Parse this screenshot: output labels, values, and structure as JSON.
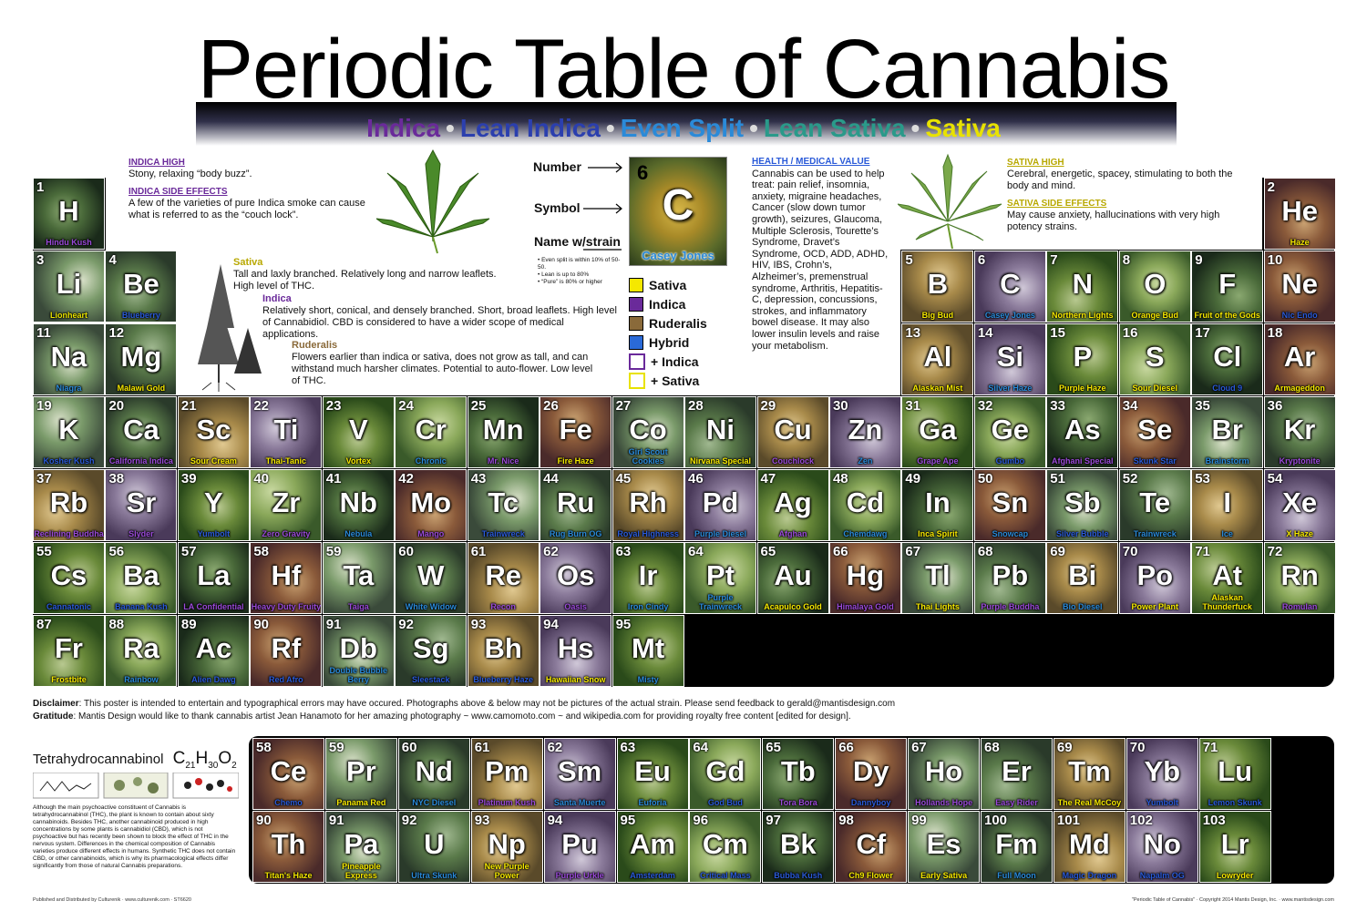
{
  "title": "Periodic Table of Cannabis",
  "types": [
    {
      "label": "Indica",
      "color": "#6a2a9a"
    },
    {
      "label": "Lean Indica",
      "color": "#2b3fae"
    },
    {
      "label": "Even Split",
      "color": "#2b8ad8"
    },
    {
      "label": "Lean Sativa",
      "color": "#2a9a8a"
    },
    {
      "label": "Sativa",
      "color": "#e8e200"
    }
  ],
  "type_separator": "•",
  "indica_info": {
    "high_heading": "INDICA HIGH",
    "high_text": "Stony, relaxing “body buzz”.",
    "side_heading": "INDICA SIDE EFFECTS",
    "side_text": "A few of the varieties of pure Indica smoke can cause what is referred to as the “couch lock”."
  },
  "sativa_info": {
    "high_heading": "SATIVA HIGH",
    "high_text": "Cerebral, energetic, spacey, stimulating to both the body and mind.",
    "side_heading": "SATIVA SIDE EFFECTS",
    "side_text": "May cause anxiety, hallucinations with very high potency strains."
  },
  "plants": {
    "sativa_label": "Sativa",
    "sativa_text": "Tall and laxly branched. Relatively long and narrow leaflets. High level of THC.",
    "indica_label": "Indica",
    "indica_text": "Relatively short, conical, and densely branched. Short, broad leaflets. High level of Cannabidiol. CBD is considered to have a wider scope of medical applications.",
    "ruderalis_label": "Ruderalis",
    "ruderalis_text": "Flowers earlier than indica or sativa, does not grow as tall, and can withstand much harsher climates. Potential to auto-flower. Low level of THC."
  },
  "key": {
    "number_label": "Number",
    "symbol_label": "Symbol",
    "name_label": "Name w/strain",
    "example_num": "6",
    "example_sym": "C",
    "example_strain": "Casey Jones",
    "notes": [
      "• Even split is within 10% of 50-50.",
      "• Lean is up to 80%",
      "• “Pure” is 80% or higher"
    ]
  },
  "legend": [
    {
      "label": "Sativa",
      "color": "#f5e800"
    },
    {
      "label": "Indica",
      "color": "#6a2a9a"
    },
    {
      "label": "Ruderalis",
      "color": "#8a6a3a"
    },
    {
      "label": "Hybrid",
      "color": "#2a6ad8"
    },
    {
      "label": "+ Indica",
      "color": "#ffffff",
      "border": "#6a2a9a"
    },
    {
      "label": "+ Sativa",
      "color": "#ffffff",
      "border": "#e8e200"
    }
  ],
  "health": {
    "heading": "HEALTH / MEDICAL VALUE",
    "text": "Cannabis can be used to help treat: pain relief, insomnia, anxiety, migraine headaches, Cancer (slow down tumor growth), seizures, Glaucoma, Multiple Sclerosis, Tourette’s Syndrome, Dravet’s Syndrome, OCD, ADD, ADHD, HIV, IBS, Crohn’s, Alzheimer’s, premenstrual syndrome, Arthritis, Hepatitis-C, depression, concussions, strokes, and inflammatory bowel disease. It may also lower insulin levels and raise your metabolism."
  },
  "elements": [
    {
      "n": "1",
      "s": "H",
      "name": "Hindu Kush",
      "c": "#9a4ad8",
      "r": 0,
      "col": 0
    },
    {
      "n": "2",
      "s": "He",
      "name": "Haze",
      "c": "#f5e800",
      "r": 0,
      "col": 17
    },
    {
      "n": "3",
      "s": "Li",
      "name": "Lionheart",
      "c": "#e8e200",
      "r": 1,
      "col": 0
    },
    {
      "n": "4",
      "s": "Be",
      "name": "Blueberry",
      "c": "#2a5ad8",
      "r": 1,
      "col": 1
    },
    {
      "n": "5",
      "s": "B",
      "name": "Big Bud",
      "c": "#f5e800",
      "r": 1,
      "col": 12
    },
    {
      "n": "6",
      "s": "C",
      "name": "Casey Jones",
      "c": "#2a8ad8",
      "r": 1,
      "col": 13
    },
    {
      "n": "7",
      "s": "N",
      "name": "Northern Lights",
      "c": "#f5e800",
      "r": 1,
      "col": 14
    },
    {
      "n": "8",
      "s": "O",
      "name": "Orange Bud",
      "c": "#f5e800",
      "r": 1,
      "col": 15
    },
    {
      "n": "9",
      "s": "F",
      "name": "Fruit of the Gods",
      "c": "#f5e800",
      "r": 1,
      "col": 16
    },
    {
      "n": "10",
      "s": "Ne",
      "name": "Nic Endo",
      "c": "#2a5ad8",
      "r": 1,
      "col": 17
    },
    {
      "n": "11",
      "s": "Na",
      "name": "Niagra",
      "c": "#2a8ad8",
      "r": 2,
      "col": 0
    },
    {
      "n": "12",
      "s": "Mg",
      "name": "Malawi Gold",
      "c": "#f5e800",
      "r": 2,
      "col": 1
    },
    {
      "n": "13",
      "s": "Al",
      "name": "Alaskan Mist",
      "c": "#f5e800",
      "r": 2,
      "col": 12
    },
    {
      "n": "14",
      "s": "Si",
      "name": "Silver Haze",
      "c": "#2a8ad8",
      "r": 2,
      "col": 13
    },
    {
      "n": "15",
      "s": "P",
      "name": "Purple Haze",
      "c": "#f5e800",
      "r": 2,
      "col": 14
    },
    {
      "n": "16",
      "s": "S",
      "name": "Sour Diesel",
      "c": "#f5e800",
      "r": 2,
      "col": 15
    },
    {
      "n": "17",
      "s": "Cl",
      "name": "Cloud 9",
      "c": "#2a5ad8",
      "r": 2,
      "col": 16
    },
    {
      "n": "18",
      "s": "Ar",
      "name": "Armageddon",
      "c": "#f5e800",
      "r": 2,
      "col": 17
    },
    {
      "n": "19",
      "s": "K",
      "name": "Kosher Kush",
      "c": "#2a5ad8",
      "r": 3,
      "col": 0
    },
    {
      "n": "20",
      "s": "Ca",
      "name": "California Indica",
      "c": "#9a4ad8",
      "r": 3,
      "col": 1
    },
    {
      "n": "21",
      "s": "Sc",
      "name": "Sour Cream",
      "c": "#f5e800",
      "r": 3,
      "col": 2
    },
    {
      "n": "22",
      "s": "Ti",
      "name": "Thai-Tanic",
      "c": "#f5e800",
      "r": 3,
      "col": 3
    },
    {
      "n": "23",
      "s": "V",
      "name": "Vortex",
      "c": "#f5e800",
      "r": 3,
      "col": 4
    },
    {
      "n": "24",
      "s": "Cr",
      "name": "Chronic",
      "c": "#2a8ad8",
      "r": 3,
      "col": 5
    },
    {
      "n": "25",
      "s": "Mn",
      "name": "Mr. Nice",
      "c": "#9a4ad8",
      "r": 3,
      "col": 6
    },
    {
      "n": "26",
      "s": "Fe",
      "name": "Fire Haze",
      "c": "#f5e800",
      "r": 3,
      "col": 7
    },
    {
      "n": "27",
      "s": "Co",
      "name": "Girl Scout Cookies",
      "c": "#2a8ad8",
      "r": 3,
      "col": 8
    },
    {
      "n": "28",
      "s": "Ni",
      "name": "Nirvana Special",
      "c": "#f5e800",
      "r": 3,
      "col": 9
    },
    {
      "n": "29",
      "s": "Cu",
      "name": "Couchlock",
      "c": "#9a4ad8",
      "r": 3,
      "col": 10
    },
    {
      "n": "30",
      "s": "Zn",
      "name": "Zen",
      "c": "#2a8ad8",
      "r": 3,
      "col": 11
    },
    {
      "n": "31",
      "s": "Ga",
      "name": "Grape Ape",
      "c": "#9a4ad8",
      "r": 3,
      "col": 12
    },
    {
      "n": "32",
      "s": "Ge",
      "name": "Gumbo",
      "c": "#2a5ad8",
      "r": 3,
      "col": 13
    },
    {
      "n": "33",
      "s": "As",
      "name": "Afghani Special",
      "c": "#9a4ad8",
      "r": 3,
      "col": 14
    },
    {
      "n": "34",
      "s": "Se",
      "name": "Skunk Star",
      "c": "#2a5ad8",
      "r": 3,
      "col": 15
    },
    {
      "n": "35",
      "s": "Br",
      "name": "Brainstorm",
      "c": "#2a8ad8",
      "r": 3,
      "col": 16
    },
    {
      "n": "36",
      "s": "Kr",
      "name": "Kryptonite",
      "c": "#9a4ad8",
      "r": 3,
      "col": 17
    },
    {
      "n": "37",
      "s": "Rb",
      "name": "Reclining Buddha",
      "c": "#9a4ad8",
      "r": 4,
      "col": 0
    },
    {
      "n": "38",
      "s": "Sr",
      "name": "Slyder",
      "c": "#9a4ad8",
      "r": 4,
      "col": 1
    },
    {
      "n": "39",
      "s": "Y",
      "name": "Yumbolt",
      "c": "#2a5ad8",
      "r": 4,
      "col": 2
    },
    {
      "n": "40",
      "s": "Zr",
      "name": "Zero Gravity",
      "c": "#9a4ad8",
      "r": 4,
      "col": 3
    },
    {
      "n": "41",
      "s": "Nb",
      "name": "Nebula",
      "c": "#2a8ad8",
      "r": 4,
      "col": 4
    },
    {
      "n": "42",
      "s": "Mo",
      "name": "Mango",
      "c": "#9a4ad8",
      "r": 4,
      "col": 5
    },
    {
      "n": "43",
      "s": "Tc",
      "name": "Trainwreck",
      "c": "#2a5ad8",
      "r": 4,
      "col": 6
    },
    {
      "n": "44",
      "s": "Ru",
      "name": "Rug Burn OG",
      "c": "#2a8ad8",
      "r": 4,
      "col": 7
    },
    {
      "n": "45",
      "s": "Rh",
      "name": "Royal Highness",
      "c": "#2a5ad8",
      "r": 4,
      "col": 8
    },
    {
      "n": "46",
      "s": "Pd",
      "name": "Purple Diesel",
      "c": "#2a8ad8",
      "r": 4,
      "col": 9
    },
    {
      "n": "47",
      "s": "Ag",
      "name": "Afghan",
      "c": "#9a4ad8",
      "r": 4,
      "col": 10
    },
    {
      "n": "48",
      "s": "Cd",
      "name": "Chemdawg",
      "c": "#2a8ad8",
      "r": 4,
      "col": 11
    },
    {
      "n": "49",
      "s": "In",
      "name": "Inca Spirit",
      "c": "#f5e800",
      "r": 4,
      "col": 12
    },
    {
      "n": "50",
      "s": "Sn",
      "name": "Snowcap",
      "c": "#2a8ad8",
      "r": 4,
      "col": 13
    },
    {
      "n": "51",
      "s": "Sb",
      "name": "Silver Bubble",
      "c": "#2a5ad8",
      "r": 4,
      "col": 14
    },
    {
      "n": "52",
      "s": "Te",
      "name": "Trainwreck",
      "c": "#2a8ad8",
      "r": 4,
      "col": 15
    },
    {
      "n": "53",
      "s": "I",
      "name": "Ice",
      "c": "#2a8ad8",
      "r": 4,
      "col": 16
    },
    {
      "n": "54",
      "s": "Xe",
      "name": "X Haze",
      "c": "#f5e800",
      "r": 4,
      "col": 17
    },
    {
      "n": "55",
      "s": "Cs",
      "name": "Cannatonic",
      "c": "#2a5ad8",
      "r": 5,
      "col": 0
    },
    {
      "n": "56",
      "s": "Ba",
      "name": "Banana Kush",
      "c": "#2a5ad8",
      "r": 5,
      "col": 1
    },
    {
      "n": "57",
      "s": "La",
      "name": "LA Confidential",
      "c": "#9a4ad8",
      "r": 5,
      "col": 2
    },
    {
      "n": "58",
      "s": "Hf",
      "name": "Heavy Duty Fruity",
      "c": "#9a4ad8",
      "r": 5,
      "col": 3
    },
    {
      "n": "59",
      "s": "Ta",
      "name": "Taiga",
      "c": "#9a4ad8",
      "r": 5,
      "col": 4
    },
    {
      "n": "60",
      "s": "W",
      "name": "White Widow",
      "c": "#2a8ad8",
      "r": 5,
      "col": 5
    },
    {
      "n": "61",
      "s": "Re",
      "name": "Recon",
      "c": "#9a4ad8",
      "r": 5,
      "col": 6
    },
    {
      "n": "62",
      "s": "Os",
      "name": "Oasis",
      "c": "#9a4ad8",
      "r": 5,
      "col": 7
    },
    {
      "n": "63",
      "s": "Ir",
      "name": "Iron Cindy",
      "c": "#2a8ad8",
      "r": 5,
      "col": 8
    },
    {
      "n": "64",
      "s": "Pt",
      "name": "Purple Trainwreck",
      "c": "#2a8ad8",
      "r": 5,
      "col": 9
    },
    {
      "n": "65",
      "s": "Au",
      "name": "Acapulco Gold",
      "c": "#f5e800",
      "r": 5,
      "col": 10
    },
    {
      "n": "66",
      "s": "Hg",
      "name": "Himalaya Gold",
      "c": "#9a4ad8",
      "r": 5,
      "col": 11
    },
    {
      "n": "67",
      "s": "Tl",
      "name": "Thai Lights",
      "c": "#f5e800",
      "r": 5,
      "col": 12
    },
    {
      "n": "68",
      "s": "Pb",
      "name": "Purple Buddha",
      "c": "#9a4ad8",
      "r": 5,
      "col": 13
    },
    {
      "n": "69",
      "s": "Bi",
      "name": "Bio Diesel",
      "c": "#2a8ad8",
      "r": 5,
      "col": 14
    },
    {
      "n": "70",
      "s": "Po",
      "name": "Power Plant",
      "c": "#f5e800",
      "r": 5,
      "col": 15
    },
    {
      "n": "71",
      "s": "At",
      "name": "Alaskan Thunderfuck",
      "c": "#f5e800",
      "r": 5,
      "col": 16
    },
    {
      "n": "72",
      "s": "Rn",
      "name": "Romulan",
      "c": "#9a4ad8",
      "r": 5,
      "col": 17
    },
    {
      "n": "87",
      "s": "Fr",
      "name": "Frostbite",
      "c": "#f5e800",
      "r": 6,
      "col": 0
    },
    {
      "n": "88",
      "s": "Ra",
      "name": "Rainbow",
      "c": "#2a8ad8",
      "r": 6,
      "col": 1
    },
    {
      "n": "89",
      "s": "Ac",
      "name": "Alien Dawg",
      "c": "#2a5ad8",
      "r": 6,
      "col": 2
    },
    {
      "n": "90",
      "s": "Rf",
      "name": "Red Afro",
      "c": "#2a5ad8",
      "r": 6,
      "col": 3
    },
    {
      "n": "91",
      "s": "Db",
      "name": "Double Bubble Berry",
      "c": "#2a8ad8",
      "r": 6,
      "col": 4
    },
    {
      "n": "92",
      "s": "Sg",
      "name": "Sleestack",
      "c": "#2a5ad8",
      "r": 6,
      "col": 5
    },
    {
      "n": "93",
      "s": "Bh",
      "name": "Blueberry Haze",
      "c": "#2a5ad8",
      "r": 6,
      "col": 6
    },
    {
      "n": "94",
      "s": "Hs",
      "name": "Hawaiian Snow",
      "c": "#f5e800",
      "r": 6,
      "col": 7
    },
    {
      "n": "95",
      "s": "Mt",
      "name": "Misty",
      "c": "#2a8ad8",
      "r": 6,
      "col": 8
    }
  ],
  "lower_elements": [
    {
      "n": "58",
      "s": "Ce",
      "name": "Chemo",
      "c": "#2a5ad8",
      "r": 0,
      "col": 0
    },
    {
      "n": "59",
      "s": "Pr",
      "name": "Panama Red",
      "c": "#f5e800",
      "r": 0,
      "col": 1
    },
    {
      "n": "60",
      "s": "Nd",
      "name": "NYC Diesel",
      "c": "#2a8ad8",
      "r": 0,
      "col": 2
    },
    {
      "n": "61",
      "s": "Pm",
      "name": "Platinum Kush",
      "c": "#9a4ad8",
      "r": 0,
      "col": 3
    },
    {
      "n": "62",
      "s": "Sm",
      "name": "Santa Muerte",
      "c": "#2a8ad8",
      "r": 0,
      "col": 4
    },
    {
      "n": "63",
      "s": "Eu",
      "name": "Euforia",
      "c": "#2a8ad8",
      "r": 0,
      "col": 5
    },
    {
      "n": "64",
      "s": "Gd",
      "name": "God Bud",
      "c": "#2a5ad8",
      "r": 0,
      "col": 6
    },
    {
      "n": "65",
      "s": "Tb",
      "name": "Tora Bora",
      "c": "#9a4ad8",
      "r": 0,
      "col": 7
    },
    {
      "n": "66",
      "s": "Dy",
      "name": "Dannyboy",
      "c": "#2a5ad8",
      "r": 0,
      "col": 8
    },
    {
      "n": "67",
      "s": "Ho",
      "name": "Hollands Hope",
      "c": "#9a4ad8",
      "r": 0,
      "col": 9
    },
    {
      "n": "68",
      "s": "Er",
      "name": "Easy Rider",
      "c": "#9a4ad8",
      "r": 0,
      "col": 10
    },
    {
      "n": "69",
      "s": "Tm",
      "name": "The Real McCoy",
      "c": "#f5e800",
      "r": 0,
      "col": 11
    },
    {
      "n": "70",
      "s": "Yb",
      "name": "Yumbolt",
      "c": "#2a5ad8",
      "r": 0,
      "col": 12
    },
    {
      "n": "71",
      "s": "Lu",
      "name": "Lemon Skunk",
      "c": "#2a5ad8",
      "r": 0,
      "col": 13
    },
    {
      "n": "90",
      "s": "Th",
      "name": "Titan's Haze",
      "c": "#f5e800",
      "r": 1,
      "col": 0
    },
    {
      "n": "91",
      "s": "Pa",
      "name": "Pineapple Express",
      "c": "#f5e800",
      "r": 1,
      "col": 1
    },
    {
      "n": "92",
      "s": "U",
      "name": "Ultra Skunk",
      "c": "#2a8ad8",
      "r": 1,
      "col": 2
    },
    {
      "n": "93",
      "s": "Np",
      "name": "New Purple Power",
      "c": "#f5e800",
      "r": 1,
      "col": 3
    },
    {
      "n": "94",
      "s": "Pu",
      "name": "Purple Urkle",
      "c": "#9a4ad8",
      "r": 1,
      "col": 4
    },
    {
      "n": "95",
      "s": "Am",
      "name": "Amsterdam",
      "c": "#2a5ad8",
      "r": 1,
      "col": 5
    },
    {
      "n": "96",
      "s": "Cm",
      "name": "Critical Mass",
      "c": "#2a5ad8",
      "r": 1,
      "col": 6
    },
    {
      "n": "97",
      "s": "Bk",
      "name": "Bubba Kush",
      "c": "#2a5ad8",
      "r": 1,
      "col": 7
    },
    {
      "n": "98",
      "s": "Cf",
      "name": "Ch9 Flower",
      "c": "#f5e800",
      "r": 1,
      "col": 8
    },
    {
      "n": "99",
      "s": "Es",
      "name": "Early Sativa",
      "c": "#f5e800",
      "r": 1,
      "col": 9
    },
    {
      "n": "100",
      "s": "Fm",
      "name": "Full Moon",
      "c": "#2a8ad8",
      "r": 1,
      "col": 10
    },
    {
      "n": "101",
      "s": "Md",
      "name": "Magic Dragon",
      "c": "#2a5ad8",
      "r": 1,
      "col": 11
    },
    {
      "n": "102",
      "s": "No",
      "name": "Napalm OG",
      "c": "#2a5ad8",
      "r": 1,
      "col": 12
    },
    {
      "n": "103",
      "s": "Lr",
      "name": "Lowryder",
      "c": "#f5e800",
      "r": 1,
      "col": 13
    }
  ],
  "disclaimer": {
    "d_label": "Disclaimer",
    "d_text": ": This poster is intended to entertain and typographical errors may have occured. Photographs above & below may not be pictures of the actual strain. Please send feedback to gerald@mantisdesign.com",
    "g_label": "Gratitude",
    "g_text": ": Mantis Design would like to thank cannabis artist Jean Hanamoto for her amazing photography ~ www.camomoto.com ~ and wikipedia.com for providing royalty free content [edited for design]."
  },
  "thc": {
    "name": "Tetrahydrocannabinol",
    "formula": "C21H30O2",
    "text": "Although the main psychoactive constituent of Cannabis is tetrahydrocannabinol (THC), the plant is known to contain about sixty cannabinoids. Besides THC, another cannabinoid produced in high concentrations by some plants is cannabidiol (CBD), which is not psychoactive but has recently been shown to block the effect of THC in the nervous system. Differences in the chemical composition of Cannabis varieties produce different effects in humans. Synthetic THC does not contain CBD, or other cannabinoids, which is why its pharmacological effects differ significantly from those of natural Cannabis preparations."
  },
  "footer": {
    "left": "Published and Distributed by Culturenik · www.culturenik.com · ST6620",
    "right": "\"Periodic Table of Cannabis\" · Copyright 2014 Mantis Design, Inc. · www.mantisdesign.com"
  }
}
